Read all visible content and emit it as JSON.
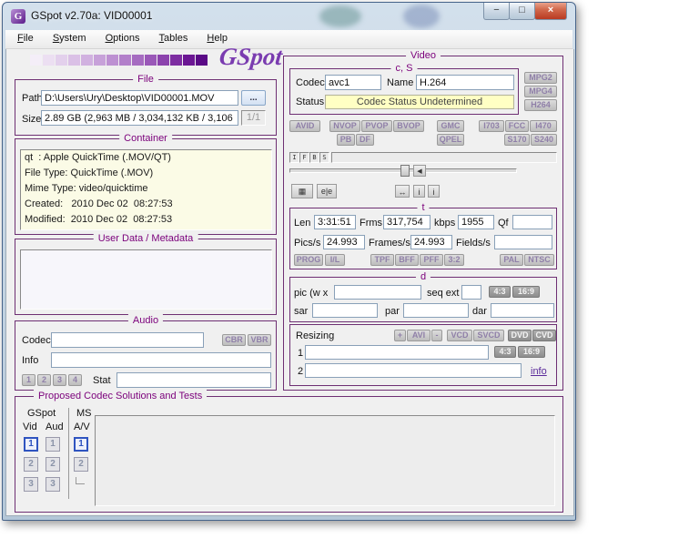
{
  "window": {
    "title": "GSpot v2.70a: VID00001",
    "controls": {
      "minimize": "−",
      "maximize": "□",
      "close": "×"
    }
  },
  "menu": {
    "items": [
      "File",
      "System",
      "Options",
      "Tables",
      "Help"
    ]
  },
  "logo": {
    "text": "GSpot",
    "gradient": [
      "#f4eef8",
      "#ecdff2",
      "#e3d0ec",
      "#dac0e6",
      "#d1b1e0",
      "#c7a1d9",
      "#bd90d2",
      "#b27fca",
      "#a66cc1",
      "#9a58b8",
      "#8c43ad",
      "#7d2da1",
      "#6b1693",
      "#5a0a86"
    ]
  },
  "file": {
    "title": "File",
    "path_label": "Path",
    "path_value": "D:\\Users\\Ury\\Desktop\\VID00001.MOV",
    "browse_label": "...",
    "size_label": "Size",
    "size_value": "2.89 GB (2,963 MB / 3,034,132 KB / 3,106",
    "page_indicator": "1/1"
  },
  "container": {
    "title": "Container",
    "lines": [
      "qt  : Apple QuickTime (.MOV/QT)",
      "File Type: QuickTime (.MOV)",
      "Mime Type: video/quicktime",
      "Created:   2010 Dec 02  08:27:53",
      "Modified:  2010 Dec 02  08:27:53"
    ]
  },
  "user_data": {
    "title": "User Data / Metadata"
  },
  "audio": {
    "title": "Audio",
    "codec_label": "Codec",
    "cbr": "CBR",
    "vbr": "VBR",
    "info_label": "Info",
    "track_buttons": [
      "1",
      "2",
      "3",
      "4"
    ],
    "stat_label": "Stat"
  },
  "video": {
    "title": "Video",
    "cs": {
      "title": "c, S",
      "codec_label": "Codec",
      "codec_value": "avc1",
      "name_label": "Name",
      "name_value": "H.264",
      "status_label": "Status",
      "status_value": "Codec Status Undetermined"
    },
    "format_buttons": [
      "MPG2",
      "MPG4",
      "H264"
    ],
    "flags_row1": [
      "AVID",
      "NVOP",
      "PVOP",
      "BVOP",
      "GMC",
      "I703",
      "FCC",
      "I470"
    ],
    "flags_row2": [
      "PB",
      "DF",
      "QPEL",
      "S170",
      "S240"
    ],
    "ifbs": [
      "I",
      "F",
      "B",
      "S"
    ],
    "transport": {
      "clapper": "▦",
      "ee": "e|e",
      "marker": "◀",
      "arrows": "↔",
      "info1": "i",
      "info2": "i"
    },
    "t": {
      "title": "t",
      "len_label": "Len",
      "len_value": "3:31:51",
      "frms_label": "Frms",
      "frms_value": "317,754",
      "kbps_label": "kbps",
      "kbps_value": "1955",
      "qf_label": "Qf",
      "qf_value": "",
      "pics_label": "Pics/s",
      "pics_value": "24.993",
      "frames_label": "Frames/s",
      "frames_value": "24.993",
      "fields_label": "Fields/s",
      "fields_value": "",
      "flag_buttons": [
        "PROG",
        "I/L",
        "TPF",
        "BFF",
        "PFF",
        "3:2",
        "PAL",
        "NTSC"
      ]
    },
    "d": {
      "title": "d",
      "pic_label": "pic (w x",
      "seq_ext_label": "seq ext",
      "ratio_buttons": [
        "4:3",
        "16:9"
      ],
      "sar_label": "sar",
      "par_label": "par",
      "dar_label": "dar"
    },
    "resizing": {
      "label": "Resizing",
      "buttons": [
        "+",
        "AVI",
        "-",
        "VCD",
        "SVCD",
        "DVD",
        "CVD"
      ],
      "row1_label": "1",
      "ratio_buttons": [
        "4:3",
        "16:9"
      ],
      "row2_label": "2",
      "info_link": "info"
    }
  },
  "proposed": {
    "title": "Proposed Codec Solutions and Tests",
    "gspot_label": "GSpot",
    "ms_label": "MS",
    "vid_label": "Vid",
    "aud_label": "Aud",
    "av_label": "A/V",
    "vid_buttons": [
      "1",
      "2",
      "3"
    ],
    "aud_buttons": [
      "1",
      "2",
      "3"
    ],
    "av_buttons": [
      "1",
      "2"
    ]
  },
  "colors": {
    "accent_purple": "#7b007b",
    "status_yellow": "#ffffc4",
    "container_cream": "#fbfbe6",
    "selected_blue": "#2f54c0"
  }
}
